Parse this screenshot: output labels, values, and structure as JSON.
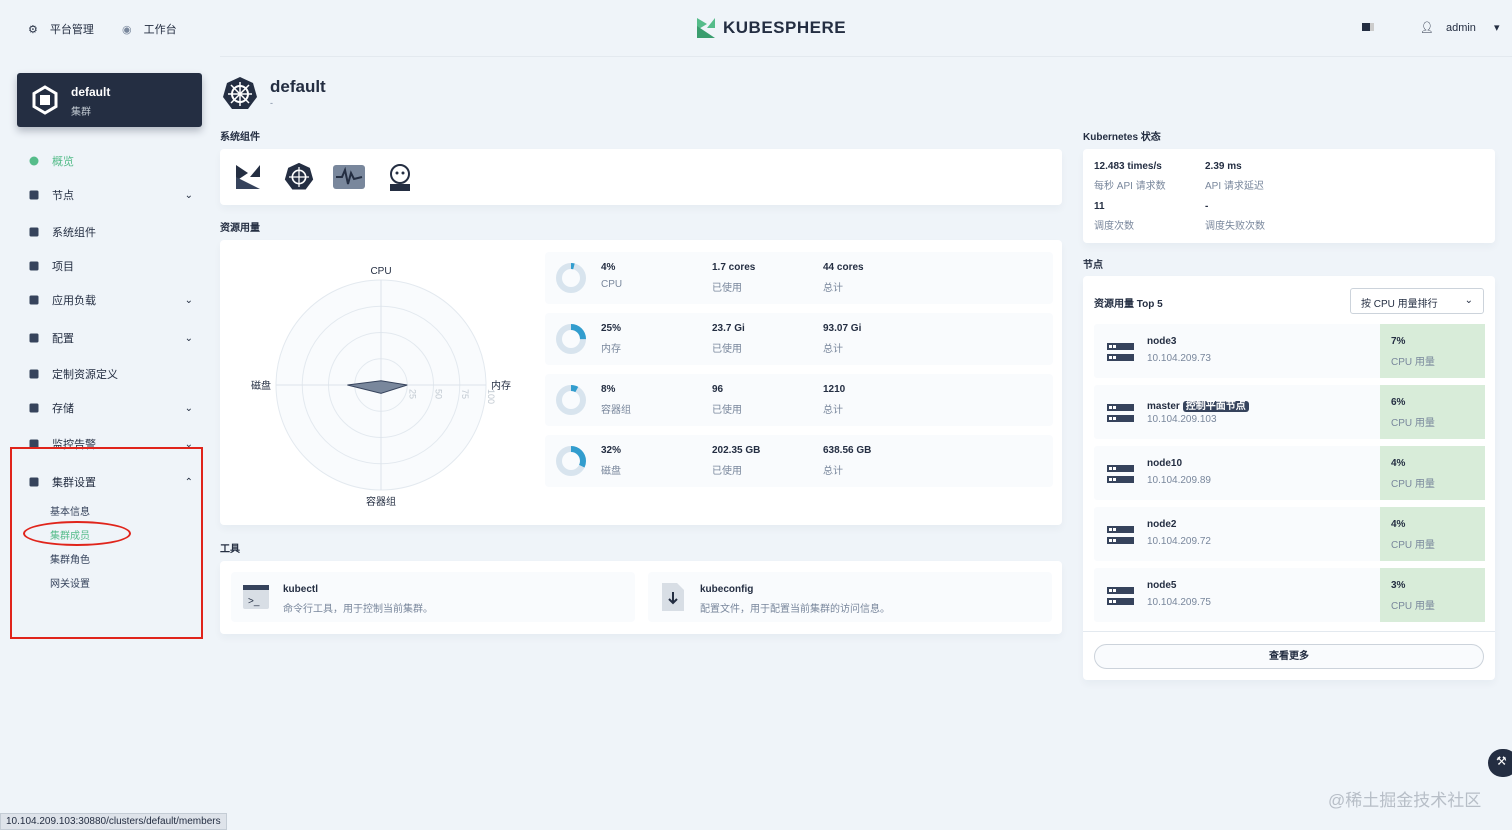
{
  "topnav": {
    "platform": "平台管理",
    "workbench": "工作台",
    "brand": "KUBESPHERE",
    "user": "admin"
  },
  "cluster": {
    "name": "default",
    "type": "集群"
  },
  "sidebar": {
    "items": [
      {
        "label": "概览",
        "active": true
      },
      {
        "label": "节点"
      },
      {
        "label": "系统组件"
      },
      {
        "label": "项目"
      },
      {
        "label": "应用负载"
      },
      {
        "label": "配置"
      },
      {
        "label": "定制资源定义"
      },
      {
        "label": "存储"
      },
      {
        "label": "监控告警"
      },
      {
        "label": "集群设置"
      }
    ],
    "settings_sub": [
      "基本信息",
      "集群成员",
      "集群角色",
      "网关设置"
    ]
  },
  "header": {
    "title": "default",
    "desc": "-"
  },
  "sections": {
    "components": "系统组件",
    "resources": "资源用量",
    "tools": "工具",
    "k8s": "Kubernetes 状态",
    "nodes": "节点"
  },
  "chart_data": {
    "type": "radar",
    "axes": [
      "CPU",
      "内存",
      "容器组",
      "磁盘"
    ],
    "values": [
      4,
      25,
      8,
      32
    ],
    "ticks": [
      "25",
      "50",
      "75",
      "100"
    ],
    "range": [
      0,
      100
    ]
  },
  "usage": [
    {
      "pct": "4%",
      "name": "CPU",
      "used": "1.7 cores",
      "used_l": "已使用",
      "total": "44 cores",
      "total_l": "总计",
      "frac": 0.04
    },
    {
      "pct": "25%",
      "name": "内存",
      "used": "23.7 Gi",
      "used_l": "已使用",
      "total": "93.07 Gi",
      "total_l": "总计",
      "frac": 0.25
    },
    {
      "pct": "8%",
      "name": "容器组",
      "used": "96",
      "used_l": "已使用",
      "total": "1210",
      "total_l": "总计",
      "frac": 0.08
    },
    {
      "pct": "32%",
      "name": "磁盘",
      "used": "202.35 GB",
      "used_l": "已使用",
      "total": "638.56 GB",
      "total_l": "总计",
      "frac": 0.32
    }
  ],
  "tools": [
    {
      "name": "kubectl",
      "desc": "命令行工具，用于控制当前集群。"
    },
    {
      "name": "kubeconfig",
      "desc": "配置文件，用于配置当前集群的访问信息。"
    }
  ],
  "k8s": [
    {
      "v": "12.483 times/s",
      "l": "每秒 API 请求数"
    },
    {
      "v": "2.39 ms",
      "l": "API 请求延迟"
    },
    {
      "v": "11",
      "l": "调度次数"
    },
    {
      "v": "-",
      "l": "调度失败次数"
    }
  ],
  "nodes_panel": {
    "title": "资源用量 Top 5",
    "sort": "按 CPU 用量排行",
    "more": "查看更多",
    "metric": "CPU 用量",
    "master_badge": "控制平面节点",
    "list": [
      {
        "name": "node3",
        "ip": "10.104.209.73",
        "pct": "7%"
      },
      {
        "name": "master",
        "ip": "10.104.209.103",
        "pct": "6%"
      },
      {
        "name": "node10",
        "ip": "10.104.209.89",
        "pct": "4%"
      },
      {
        "name": "node2",
        "ip": "10.104.209.72",
        "pct": "4%"
      },
      {
        "name": "node5",
        "ip": "10.104.209.75",
        "pct": "3%"
      }
    ]
  },
  "status_url": "10.104.209.103:30880/clusters/default/members",
  "watermark": "@稀土掘金技术社区",
  "colors": {
    "accent": "#55bc8a",
    "dark": "#242e42",
    "blue": "#329dce",
    "annotation": "#e0241b"
  }
}
